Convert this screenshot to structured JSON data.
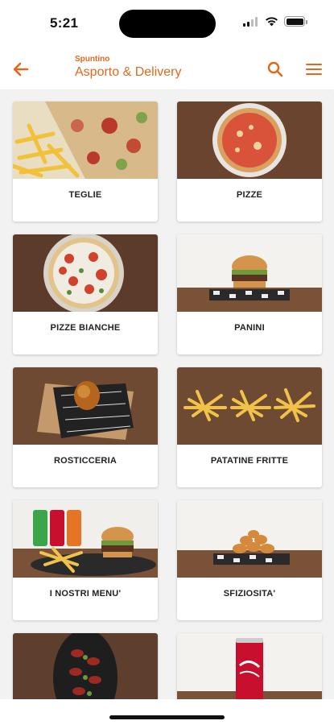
{
  "status_bar": {
    "time": "5:21"
  },
  "header": {
    "subtitle": "Spuntino",
    "title": "Asporto & Delivery",
    "back_icon": "arrow-left-icon",
    "search_icon": "search-icon",
    "menu_icon": "hamburger-menu-icon",
    "accent_color": "#e0691f"
  },
  "categories": [
    {
      "label": "TEGLIE",
      "image": "pizza-tray-with-fries"
    },
    {
      "label": "PIZZE",
      "image": "margherita-pizza"
    },
    {
      "label": "PIZZE BIANCHE",
      "image": "white-pizza-with-tomatoes"
    },
    {
      "label": "PANINI",
      "image": "burger-on-board"
    },
    {
      "label": "ROSTICCERIA",
      "image": "arancino-on-paper"
    },
    {
      "label": "PATATINE FRITTE",
      "image": "french-fries-bowls"
    },
    {
      "label": "I NOSTRI MENU'",
      "image": "burger-fries-drinks"
    },
    {
      "label": "SFIZIOSITA'",
      "image": "chicken-nuggets"
    },
    {
      "label": "",
      "image": "meat-platter"
    },
    {
      "label": "",
      "image": "coca-cola-can"
    }
  ]
}
